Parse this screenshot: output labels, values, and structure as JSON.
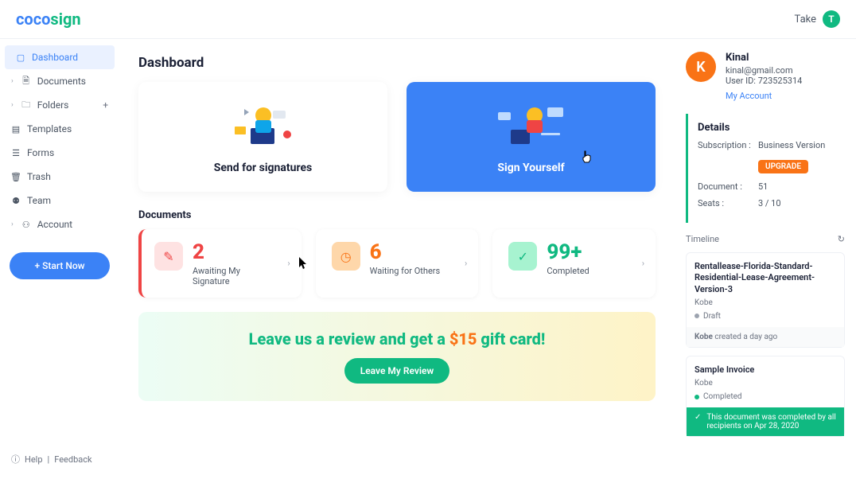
{
  "header": {
    "logo_coco": "coco",
    "logo_sign": "sign",
    "take": "Take",
    "avatar_letter": "T"
  },
  "sidebar": {
    "items": [
      {
        "label": "Dashboard"
      },
      {
        "label": "Documents"
      },
      {
        "label": "Folders"
      },
      {
        "label": "Templates"
      },
      {
        "label": "Forms"
      },
      {
        "label": "Trash"
      },
      {
        "label": "Team"
      },
      {
        "label": "Account"
      }
    ],
    "start": "+  Start Now",
    "help": "Help",
    "feedback": "Feedback",
    "sep": "|"
  },
  "main": {
    "title": "Dashboard",
    "send_card": "Send for signatures",
    "sign_card": "Sign Yourself",
    "documents_title": "Documents",
    "stats": {
      "awaiting": {
        "num": "2",
        "label": "Awaiting My Signature"
      },
      "waiting": {
        "num": "6",
        "label": "Waiting for Others"
      },
      "completed": {
        "num": "99+",
        "label": "Completed"
      }
    },
    "review": {
      "pre": "Leave us a review and get a ",
      "amt": "$15",
      "post": " gift card!",
      "btn": "Leave My Review"
    }
  },
  "profile": {
    "letter": "K",
    "name": "Kinal",
    "email": "kinal@gmail.com",
    "userid": "User ID: 723525314",
    "my_account": "My Account"
  },
  "details": {
    "title": "Details",
    "sub_label": "Subscription :",
    "sub_val": "Business Version",
    "upgrade": "UPGRADE",
    "doc_label": "Document :",
    "doc_val": "51",
    "seats_label": "Seats :",
    "seats_val": "3 / 10"
  },
  "timeline": {
    "title": "Timeline",
    "items": [
      {
        "title": "Rentallease-Florida-Standard-Residential-Lease-Agreement-Version-3",
        "user": "Kobe",
        "status": "Draft",
        "footer_bold": "Kobe",
        "footer_rest": " created a day ago"
      },
      {
        "title": "Sample Invoice",
        "user": "Kobe",
        "status": "Completed",
        "footer": "This document was completed by all recipients on Apr 28, 2020"
      }
    ]
  }
}
